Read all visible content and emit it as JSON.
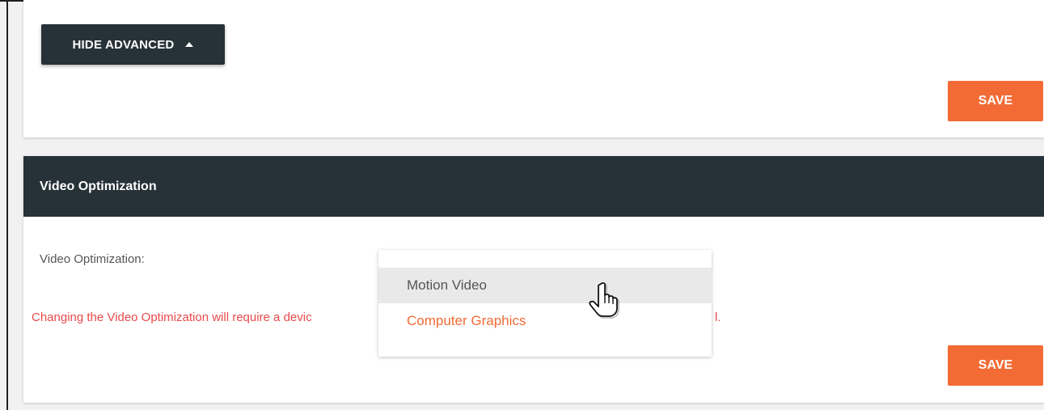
{
  "advanced_section": {
    "toggle_label": "HIDE ADVANCED",
    "save_label": "SAVE"
  },
  "video_optimization": {
    "header_title": "Video Optimization",
    "field_label": "Video Optimization:",
    "warning_visible_start": "Changing the Video Optimization will require a devic",
    "warning_visible_end": "l.",
    "options": [
      "Motion Video",
      "Computer Graphics"
    ],
    "hovered_option": "Motion Video",
    "save_label": "SAVE"
  },
  "colors": {
    "accent": "#f26b35",
    "header_bg": "#263238",
    "warning": "#e94a4a"
  },
  "icons": {
    "caret": "caret-up-icon",
    "cursor": "hand-pointer-cursor-icon"
  }
}
